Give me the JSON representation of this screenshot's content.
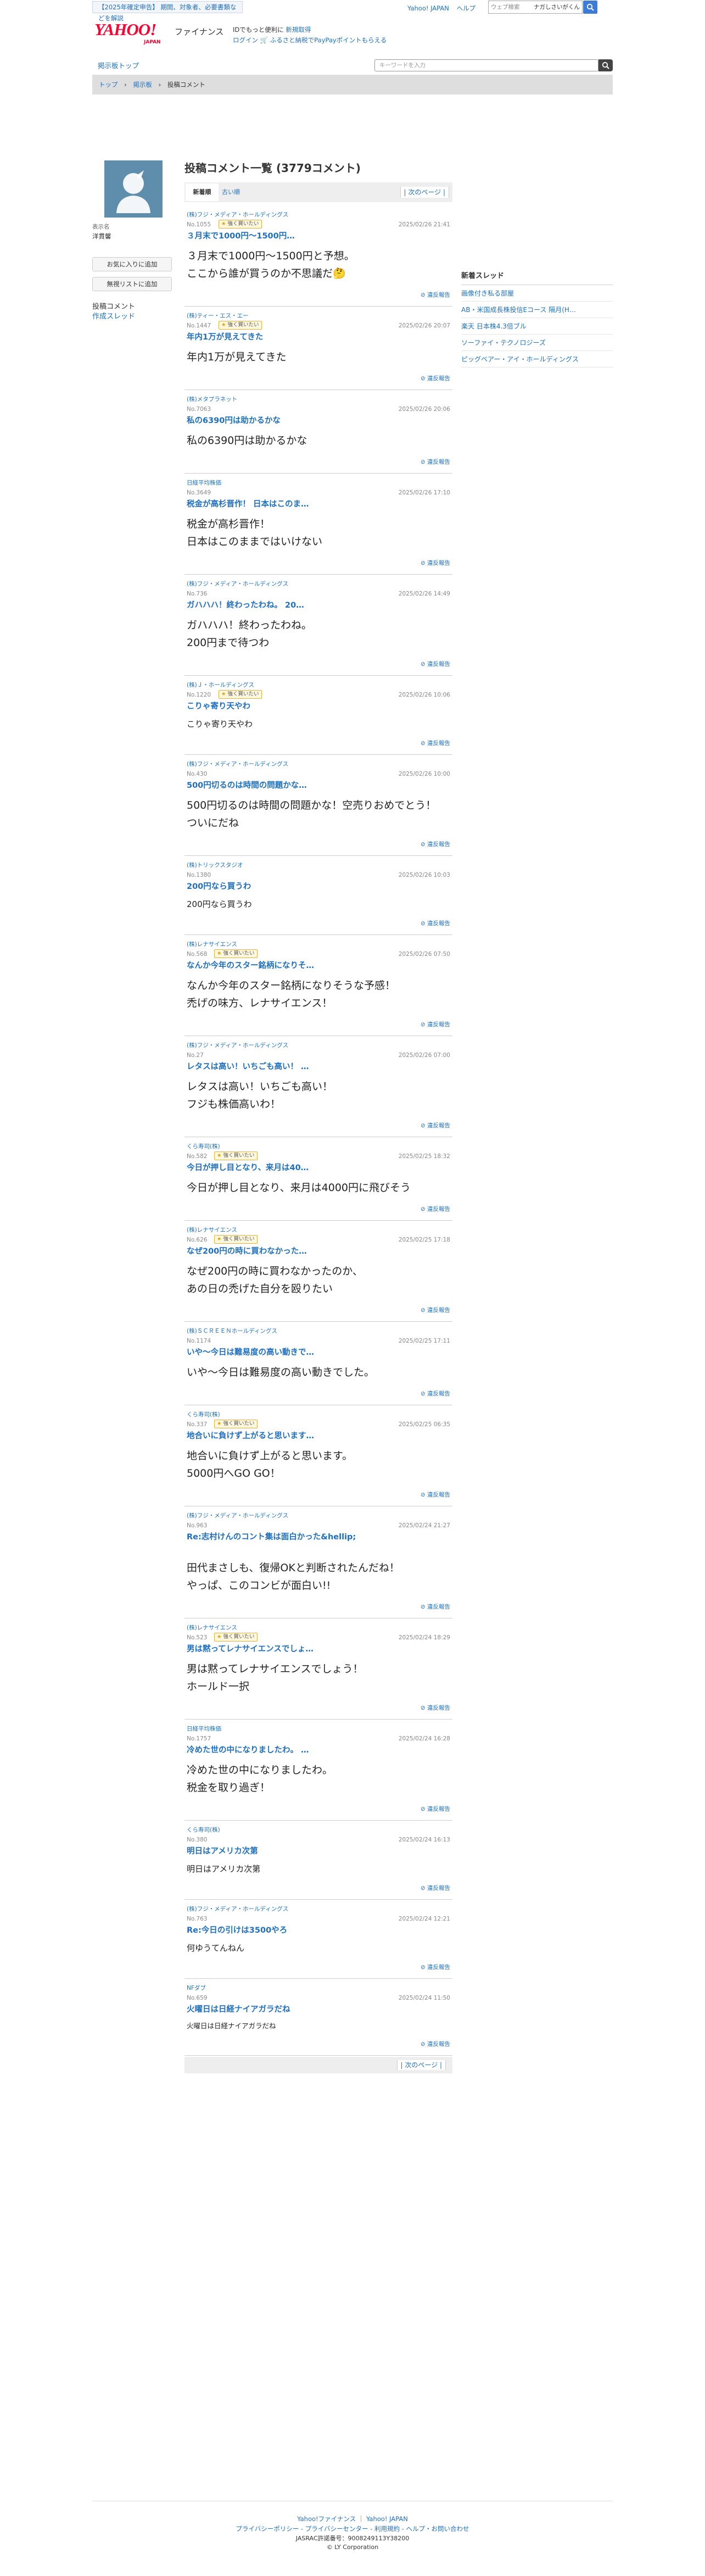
{
  "header": {
    "notice": "【2025年確定申告】 期間、対象者、必要書類などを解説",
    "top_links": [
      "Yahoo! JAPAN",
      "ヘルプ"
    ],
    "web_search_placeholder": "ウェブ検索",
    "web_search_value": "ナガしさいがくん",
    "logo_text": "YAHOO!",
    "logo_sub": "JAPAN",
    "finance_label": "ファイナンス",
    "promo_line1_text": "IDでもっと便利に",
    "promo_line1_link": "新規取得",
    "login_label": "ログイン",
    "promo_line2": "ふるさと納税でPayPayポイントもらえる",
    "board_top": "掲示板トップ",
    "keyword_placeholder": "キーワードを入力"
  },
  "breadcrumb": [
    "トップ",
    "›",
    "掲示板",
    "›",
    "投稿コメント"
  ],
  "sidebar": {
    "display_name_label": "表示名",
    "username": "洋貫馨",
    "favorite_button": "お気に入りに追加",
    "ignore_button": "無視リストに追加",
    "nav_current": "投稿コメント",
    "nav_threads": "作成スレッド"
  },
  "main": {
    "heading": "投稿コメント一覧 (3779コメント)",
    "tab_new": "新着順",
    "tab_old": "古い順",
    "next_page": "次のページ",
    "report_label": "違反報告",
    "posts": [
      {
        "company": "(株)フジ・メディア・ホールディングス",
        "no": "No.1055",
        "badge": "強く買いたい",
        "date": "2025/02/26 21:41",
        "title": "３月末で1000円〜1500円…",
        "body": "３月末で1000円〜1500円と予想。\nここから誰が買うのか不思議だ🤔"
      },
      {
        "company": "(株)ティー・エス・エー",
        "no": "No.1447",
        "badge": "強く買いたい",
        "date": "2025/02/26 20:07",
        "title": "年内1万が見えてきた",
        "body": "年内1万が見えてきた"
      },
      {
        "company": "(株)メタプラネット",
        "no": "No.7063",
        "badge": "",
        "date": "2025/02/26 20:06",
        "title": "私の6390円は助かるかな",
        "body": "私の6390円は助かるかな"
      },
      {
        "company": "日経平均株価",
        "no": "No.3649",
        "badge": "",
        "date": "2025/02/26 17:10",
        "title": "税金が高杉晋作！ 日本はこのま…",
        "body": "税金が高杉晋作！\n日本はこのままではいけない"
      },
      {
        "company": "(株)フジ・メディア・ホールディングス",
        "no": "No.736",
        "badge": "",
        "date": "2025/02/26 14:49",
        "title": "ガハハハ！終わったわね。 20…",
        "body": "ガハハハ！終わったわね。\n200円まで待つわ"
      },
      {
        "company": "(株)Ｊ・ホールディングス",
        "no": "No.1220",
        "badge": "強く買いたい",
        "date": "2025/02/26 10:06",
        "title": "こりゃ寄り天やわ",
        "body": "こりゃ寄り天やわ"
      },
      {
        "company": "(株)フジ・メディア・ホールディングス",
        "no": "No.430",
        "badge": "",
        "date": "2025/02/26 10:00",
        "title": "500円切るのは時間の問題かな…",
        "body": "500円切るのは時間の問題かな！空売りおめでとう！ついにだね"
      },
      {
        "company": "(株)トリックスタジオ",
        "no": "No.1380",
        "badge": "",
        "date": "2025/02/26 10:03",
        "title": "200円なら買うわ",
        "body": "200円なら買うわ"
      },
      {
        "company": "(株)レナサイエンス",
        "no": "No.568",
        "badge": "強く買いたい",
        "date": "2025/02/26 07:50",
        "title": "なんか今年のスター銘柄になりそ…",
        "body": "なんか今年のスター銘柄になりそうな予感！\n禿げの味方、レナサイエンス！"
      },
      {
        "company": "(株)フジ・メディア・ホールディングス",
        "no": "No.27",
        "badge": "",
        "date": "2025/02/26 07:00",
        "title": "レタスは高い！いちごも高い！ …",
        "body": "レタスは高い！いちごも高い！\nフジも株価高いわ！"
      },
      {
        "company": "くら寿司(株)",
        "no": "No.582",
        "badge": "強く買いたい",
        "date": "2025/02/25 18:32",
        "title": "今日が押し目となり、来月は40…",
        "body": "今日が押し目となり、来月は4000円に飛びそう"
      },
      {
        "company": "(株)レナサイエンス",
        "no": "No.626",
        "badge": "強く買いたい",
        "date": "2025/02/25 17:18",
        "title": "なぜ200円の時に買わなかった…",
        "body": "なぜ200円の時に買わなかったのか、\nあの日の禿げた自分を殴りたい"
      },
      {
        "company": "(株)ＳＣＲＥＥＮホールディングス",
        "no": "No.1174",
        "badge": "",
        "date": "2025/02/25 17:11",
        "title": "いや〜今日は難易度の高い動きで…",
        "body": "いや〜今日は難易度の高い動きでした。"
      },
      {
        "company": "くら寿司(株)",
        "no": "No.337",
        "badge": "強く買いたい",
        "date": "2025/02/25 06:35",
        "title": "地合いに負けず上がると思います…",
        "body": "地合いに負けず上がると思います。\n5000円へGO GO！"
      },
      {
        "company": "(株)フジ・メディア・ホールディングス",
        "no": "No.963",
        "badge": "",
        "date": "2025/02/24 21:27",
        "title": "Re:志村けんのコント集は面白かった&hellip;",
        "body": "田代まさしも、復帰OKと判断されたんだね！\nやっぱ、このコンビが面白い!!"
      },
      {
        "company": "(株)レナサイエンス",
        "no": "No.523",
        "badge": "強く買いたい",
        "date": "2025/02/24 18:29",
        "title": "男は黙ってレナサイエンスでしょ…",
        "body": "男は黙ってレナサイエンスでしょう！\nホールド一択"
      },
      {
        "company": "日経平均株価",
        "no": "No.1757",
        "badge": "",
        "date": "2025/02/24 16:28",
        "title": "冷めた世の中になりましたわ。 …",
        "body": "冷めた世の中になりましたわ。\n税金を取り過ぎ！"
      },
      {
        "company": "くら寿司(株)",
        "no": "No.380",
        "badge": "",
        "date": "2025/02/24 16:13",
        "title": "明日はアメリカ次第",
        "body": "明日はアメリカ次第"
      },
      {
        "company": "(株)フジ・メディア・ホールディングス",
        "no": "No.763",
        "badge": "",
        "date": "2025/02/24 12:21",
        "title": "Re:今日の引けは3500やろ",
        "body": "何ゆうてんねん"
      },
      {
        "company": "NFダブ",
        "no": "No.659",
        "badge": "",
        "date": "2025/02/24 11:50",
        "title": "火曜日は日経ナイアガラだね",
        "body": "火曜日は日経ナイアガラだね"
      }
    ]
  },
  "right_panel": {
    "heading": "新着スレッド",
    "items": [
      "画像付き私る部屋",
      "AB・米国成長株投信Eコース 隔月(H…",
      "楽天 日本株4.3倍ブル",
      "ソーファイ・テクノロジーズ",
      "ピッグベアー・アイ・ホールディングス"
    ]
  },
  "footer": {
    "links1": [
      "Yahoo!ファイナンス",
      "｜",
      "Yahoo! JAPAN"
    ],
    "links2": [
      "プライバシーポリシー",
      "-",
      "プライバシーセンター",
      "-",
      "利用規約",
      "-",
      "ヘルプ・お問い合わせ"
    ],
    "license": "JASRAC許諾番号：9008249113Y38200",
    "copyright": "© LY Corporation"
  },
  "colors": {
    "link": "#1f6fbf",
    "logo": "#ff0033",
    "badge_border": "#e2b340",
    "avatar": "#5f8ead"
  },
  "icons": [
    "search-icon",
    "alert-icon",
    "avatar-icon"
  ]
}
